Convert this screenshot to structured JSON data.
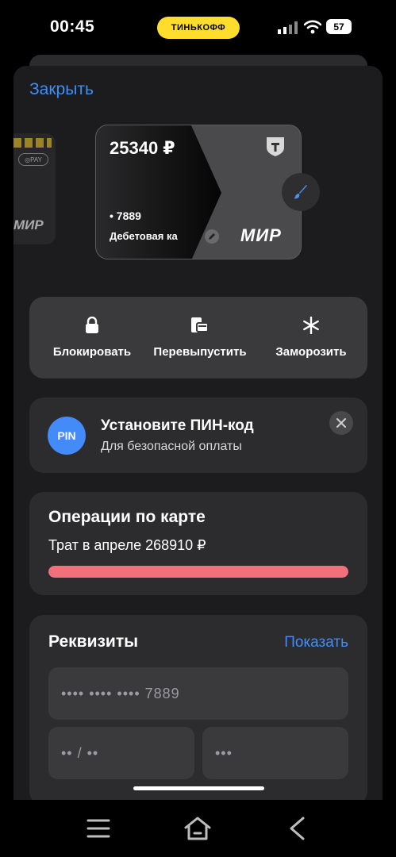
{
  "status_bar": {
    "time": "00:45",
    "bank_pill": "ТИНЬКОФФ",
    "battery": "57",
    "icons": [
      "signal-icon",
      "wifi-icon",
      "battery-icon"
    ]
  },
  "sheet": {
    "close_label": "Закрыть"
  },
  "side_card": {
    "pay_label": "PAY",
    "network": "МИР"
  },
  "card": {
    "balance": "25340 ₽",
    "number": "• 7889",
    "type": "Дебетовая ка",
    "network": "МИР"
  },
  "actions": [
    {
      "label": "Блокировать",
      "icon": "lock-icon"
    },
    {
      "label": "Перевыпустить",
      "icon": "reissue-card-icon"
    },
    {
      "label": "Заморозить",
      "icon": "snowflake-icon"
    }
  ],
  "pin": {
    "badge": "PIN",
    "title": "Установите ПИН-код",
    "subtitle": "Для безопасной оплаты"
  },
  "operations": {
    "title": "Операции по карте",
    "spent": "Трат в апреле 268910 ₽",
    "progress": 1.0,
    "bar_color": "#f0707c"
  },
  "requisites": {
    "title": "Реквизиты",
    "show_label": "Показать",
    "card_number": "•••• •••• •••• 7889",
    "expiry": "•• / ••",
    "cvc": "•••"
  },
  "colors": {
    "accent": "#3e8ef7",
    "brand_yellow": "#ffdd2d",
    "pin_blue": "#428bf9"
  },
  "navbar": {
    "icons": [
      "menu-icon",
      "home-icon",
      "back-icon"
    ]
  }
}
